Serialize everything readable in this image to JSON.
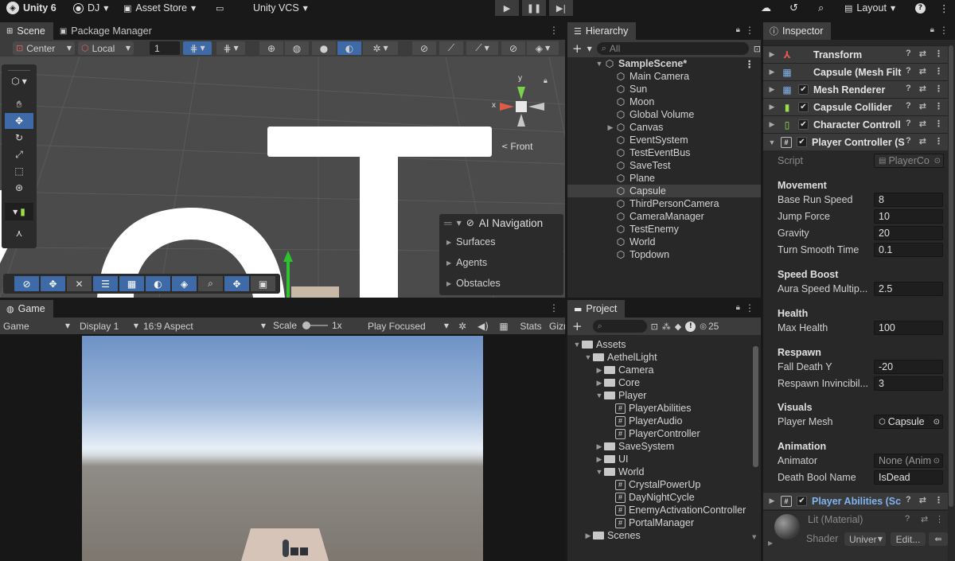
{
  "topbar": {
    "logo": "Unity 6",
    "account": "DJ",
    "asset_store": "Asset Store",
    "vcs": "Unity VCS",
    "layout": "Layout"
  },
  "scene": {
    "tabs": [
      "Scene",
      "Package Manager"
    ],
    "pivot": "Center",
    "space": "Local",
    "snap_value": "1",
    "gizmo_y": "y",
    "gizmo_x": "x",
    "view_label": "Front",
    "ai_nav": {
      "title": "AI Navigation",
      "items": [
        "Surfaces",
        "Agents",
        "Obstacles"
      ]
    }
  },
  "hierarchy": {
    "tab": "Hierarchy",
    "search_placeholder": "All",
    "scene_name": "SampleScene*",
    "items": [
      "Main Camera",
      "Sun",
      "Moon",
      "Global Volume",
      "Canvas",
      "EventSystem",
      "TestEventBus",
      "SaveTest",
      "Plane",
      "Capsule",
      "ThirdPersonCamera",
      "CameraManager",
      "TestEnemy",
      "World",
      "Topdown"
    ]
  },
  "inspector": {
    "tab": "Inspector",
    "components": [
      {
        "name": "Transform"
      },
      {
        "name": "Capsule (Mesh Filt"
      },
      {
        "name": "Mesh Renderer"
      },
      {
        "name": "Capsule Collider"
      },
      {
        "name": "Character Controll"
      },
      {
        "name": "Player Controller (S"
      }
    ],
    "script_label": "Script",
    "script_value": "PlayerCo",
    "sections": {
      "movement": "Movement",
      "speed_boost": "Speed Boost",
      "health": "Health",
      "respawn": "Respawn",
      "visuals": "Visuals",
      "animation": "Animation"
    },
    "props": {
      "base_run_speed": {
        "label": "Base Run Speed",
        "value": "8"
      },
      "jump_force": {
        "label": "Jump Force",
        "value": "10"
      },
      "gravity": {
        "label": "Gravity",
        "value": "20"
      },
      "turn_smooth_time": {
        "label": "Turn Smooth Time",
        "value": "0.1"
      },
      "aura_speed": {
        "label": "Aura Speed Multip...",
        "value": "2.5"
      },
      "max_health": {
        "label": "Max Health",
        "value": "100"
      },
      "fall_death_y": {
        "label": "Fall Death Y",
        "value": "-20"
      },
      "respawn_invincibility": {
        "label": "Respawn Invincibil...",
        "value": "3"
      },
      "player_mesh": {
        "label": "Player Mesh",
        "value": "Capsule"
      },
      "animator": {
        "label": "Animator",
        "value": "None (Anim"
      },
      "death_bool": {
        "label": "Death Bool Name",
        "value": "IsDead"
      }
    },
    "player_abilities": "Player Abilities (Sc",
    "material": "Lit (Material)",
    "shader_label": "Shader",
    "shader_value": "Univer",
    "edit_button": "Edit..."
  },
  "game": {
    "tab": "Game",
    "mode": "Game",
    "display": "Display 1",
    "aspect": "16:9 Aspect",
    "scale_label": "Scale",
    "scale_value": "1x",
    "play_mode": "Play Focused",
    "stats": "Stats",
    "gizmos": "Gizmos"
  },
  "project": {
    "tab": "Project",
    "count": "25",
    "items": [
      {
        "label": "Assets",
        "type": "folder",
        "depth": 0,
        "arrow": "open"
      },
      {
        "label": "AethelLight",
        "type": "folder",
        "depth": 1,
        "arrow": "open"
      },
      {
        "label": "Camera",
        "type": "folder",
        "depth": 2,
        "arrow": "closed"
      },
      {
        "label": "Core",
        "type": "folder",
        "depth": 2,
        "arrow": "closed"
      },
      {
        "label": "Player",
        "type": "folder",
        "depth": 2,
        "arrow": "open"
      },
      {
        "label": "PlayerAbilities",
        "type": "script",
        "depth": 3,
        "arrow": "none"
      },
      {
        "label": "PlayerAudio",
        "type": "script",
        "depth": 3,
        "arrow": "none"
      },
      {
        "label": "PlayerController",
        "type": "script",
        "depth": 3,
        "arrow": "none"
      },
      {
        "label": "SaveSystem",
        "type": "folder",
        "depth": 2,
        "arrow": "closed"
      },
      {
        "label": "UI",
        "type": "folder",
        "depth": 2,
        "arrow": "closed"
      },
      {
        "label": "World",
        "type": "folder",
        "depth": 2,
        "arrow": "open"
      },
      {
        "label": "CrystalPowerUp",
        "type": "script",
        "depth": 3,
        "arrow": "none"
      },
      {
        "label": "DayNightCycle",
        "type": "script",
        "depth": 3,
        "arrow": "none"
      },
      {
        "label": "EnemyActivationController",
        "type": "script",
        "depth": 3,
        "arrow": "none"
      },
      {
        "label": "PortalManager",
        "type": "script",
        "depth": 3,
        "arrow": "none"
      },
      {
        "label": "Scenes",
        "type": "folder",
        "depth": 1,
        "arrow": "closed"
      }
    ]
  }
}
